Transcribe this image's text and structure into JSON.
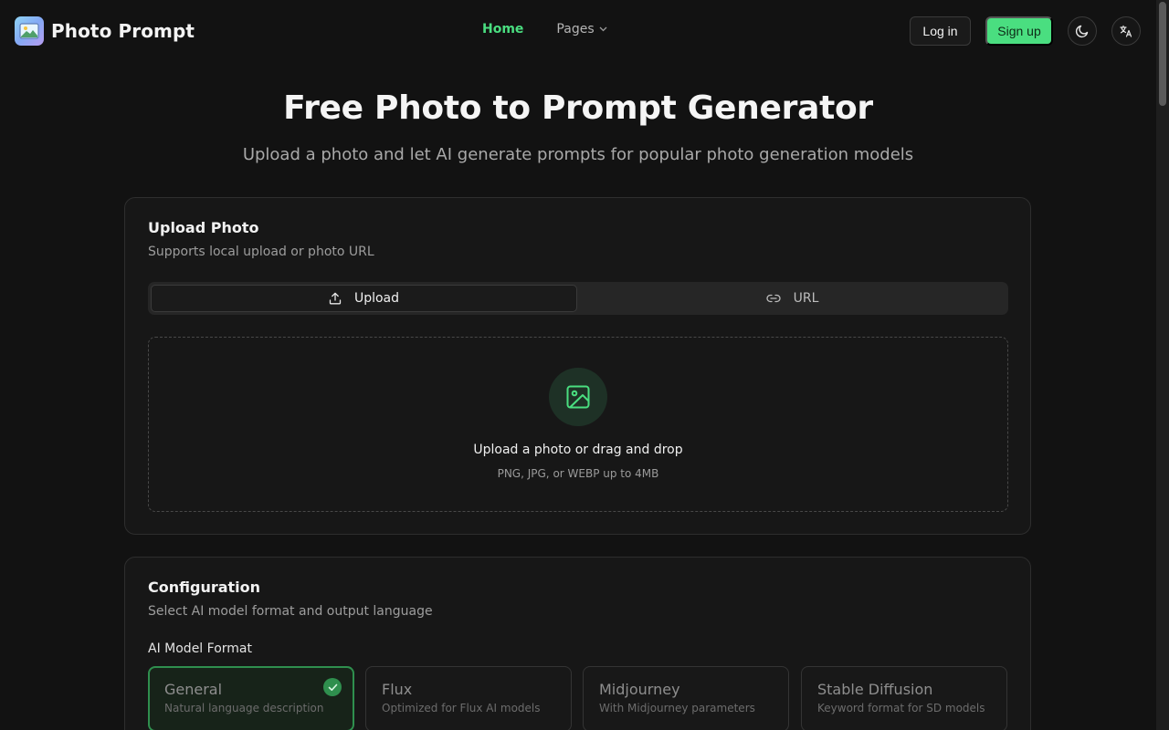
{
  "brand": {
    "name": "Photo Prompt",
    "logo_icon": "photo-logo-icon"
  },
  "nav": {
    "home": "Home",
    "pages": "Pages"
  },
  "auth": {
    "login": "Log in",
    "signup": "Sign up"
  },
  "header_icons": {
    "theme": "moon-icon",
    "language": "translate-icon"
  },
  "hero": {
    "title": "Free Photo to Prompt Generator",
    "subtitle": "Upload a photo and let AI generate prompts for popular photo generation models"
  },
  "upload_card": {
    "title": "Upload Photo",
    "description": "Supports local upload or photo URL",
    "tabs": [
      {
        "label": "Upload",
        "icon": "upload-icon",
        "active": true
      },
      {
        "label": "URL",
        "icon": "link-icon",
        "active": false
      }
    ],
    "dropzone": {
      "icon": "image-icon",
      "title": "Upload a photo or drag and drop",
      "hint": "PNG, JPG, or WEBP up to 4MB"
    }
  },
  "config_card": {
    "title": "Configuration",
    "description": "Select AI model format and output language",
    "model_label": "AI Model Format",
    "models": [
      {
        "name": "General",
        "description": "Natural language description",
        "selected": true
      },
      {
        "name": "Flux",
        "description": "Optimized for Flux AI models",
        "selected": false
      },
      {
        "name": "Midjourney",
        "description": "With Midjourney parameters",
        "selected": false
      },
      {
        "name": "Stable Diffusion",
        "description": "Keyword format for SD models",
        "selected": false
      }
    ]
  },
  "colors": {
    "accent": "#4ade80",
    "background": "#121212",
    "card": "#171717",
    "selected_border": "#2f8f4e"
  }
}
